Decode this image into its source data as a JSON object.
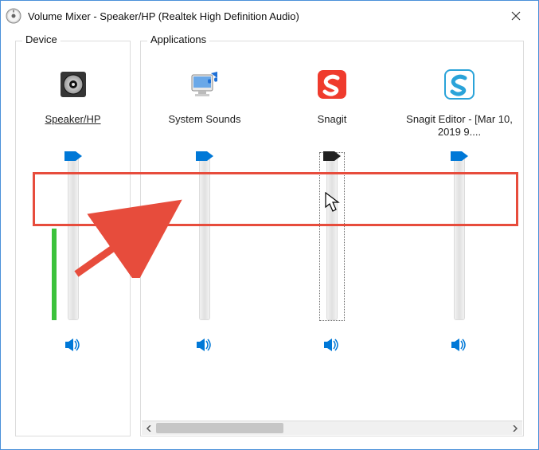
{
  "window": {
    "title": "Volume Mixer - Speaker/HP (Realtek High Definition Audio)"
  },
  "groups": {
    "device_label": "Device",
    "apps_label": "Applications"
  },
  "device": {
    "name": "Speaker/HP",
    "icon": "speaker-device-icon",
    "volume": 100,
    "level_pct": 55,
    "muted": false
  },
  "apps": [
    {
      "name": "System Sounds",
      "icon": "system-sounds-icon",
      "volume": 100,
      "muted": false,
      "focused": false
    },
    {
      "name": "Snagit",
      "icon": "snagit-icon",
      "volume": 100,
      "muted": false,
      "focused": true
    },
    {
      "name": "Snagit Editor - [Mar 10, 2019 9....",
      "icon": "snagit-editor-icon",
      "volume": 100,
      "muted": false,
      "focused": false
    }
  ],
  "colors": {
    "accent": "#0078d7",
    "annotation": "#e74c3c",
    "level": "#3cc23c"
  }
}
